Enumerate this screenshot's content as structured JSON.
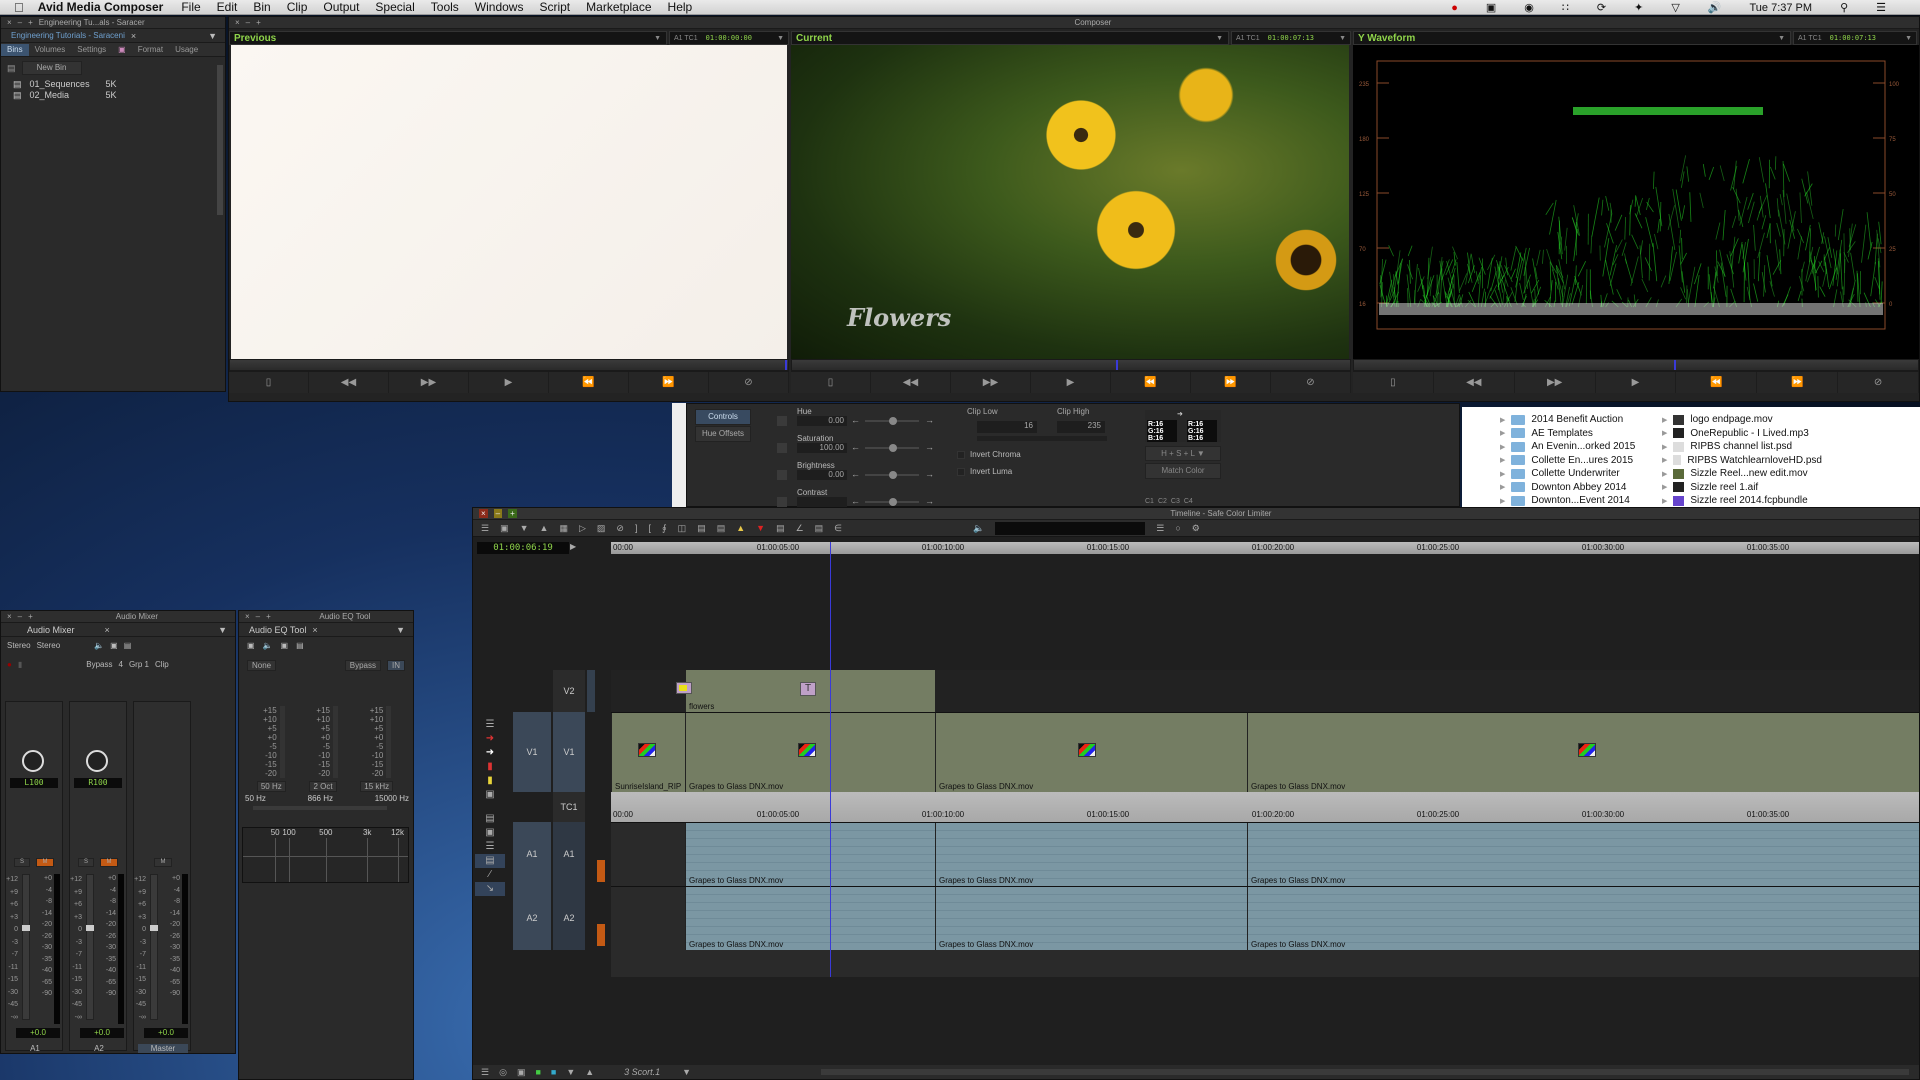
{
  "menubar": {
    "app": "Avid Media Composer",
    "items": [
      "File",
      "Edit",
      "Bin",
      "Clip",
      "Output",
      "Special",
      "Tools",
      "Windows",
      "Script",
      "Marketplace",
      "Help"
    ],
    "clock": "Tue 7:37 PM"
  },
  "project": {
    "window_title": "Engineering Tu...als - Saracer",
    "tab_label": "Engineering Tutorials - Saraceni",
    "tabs": [
      "Bins",
      "Volumes",
      "Settings",
      "Format",
      "Usage"
    ],
    "new_bin_label": "New Bin",
    "bins": [
      {
        "name": "01_Sequences",
        "size": "5K"
      },
      {
        "name": "02_Media",
        "size": "5K"
      }
    ]
  },
  "composer": {
    "title": "Composer",
    "previous": {
      "label": "Previous",
      "track": "A1 TC1",
      "tc": "01:00:00:00"
    },
    "current": {
      "label": "Current",
      "track": "A1 TC1",
      "tc": "01:00:07:13",
      "overlay_title": "Flowers"
    },
    "waveform": {
      "label": "Y Waveform",
      "track": "A1 TC1",
      "tc": "01:00:07:13",
      "left_scale": [
        "235",
        "180",
        "125",
        "70",
        "16"
      ],
      "right_scale": [
        "100",
        "75",
        "50",
        "25",
        "0"
      ]
    },
    "transport": [
      "mark-clip",
      "step-back",
      "step-forward",
      "play",
      "go-in",
      "go-out",
      "clear-marks"
    ]
  },
  "color_effect": {
    "tabs": [
      "Controls",
      "Hue Offsets"
    ],
    "params": [
      {
        "label": "Hue",
        "value": "0.00"
      },
      {
        "label": "Saturation",
        "value": "100.00"
      },
      {
        "label": "Brightness",
        "value": "0.00"
      },
      {
        "label": "Contrast",
        "value": ""
      }
    ],
    "clip_low_label": "Clip Low",
    "clip_low": "16",
    "clip_high_label": "Clip High",
    "clip_high": "235",
    "invert_chroma": "Invert Chroma",
    "invert_luma": "Invert Luma",
    "swatch_a": [
      "R:16",
      "G:16",
      "B:16"
    ],
    "swatch_b": [
      "R:16",
      "G:16",
      "B:16"
    ],
    "mode": "H + S + L",
    "match_color": "Match Color",
    "cbuttons": [
      "C1",
      "C2",
      "C3",
      "C4"
    ]
  },
  "finder": {
    "col1": [
      "2014 Benefit Auction",
      "AE Templates",
      "An Evenin...orked 2015",
      "Collette En...ures 2015",
      "Collette Underwriter",
      "Downton Abbey 2014",
      "Downton...Event 2014"
    ],
    "col2": [
      "logo endpage.mov",
      "OneRepublic - I Lived.mp3",
      "RIPBS channel list.psd",
      "RIPBS WatchlearnloveHD.psd",
      "Sizzle Reel...new edit.mov",
      "Sizzle reel 1.aif",
      "Sizzle reel 2014.fcpbundle"
    ]
  },
  "timeline": {
    "title": "Timeline - Safe Color Limiter",
    "master_tc": "01:00:06:19",
    "ruler": [
      "00:00",
      "01:00:05:00",
      "01:00:10:00",
      "01:00:15:00",
      "01:00:20:00",
      "01:00:25:00",
      "01:00:30:00",
      "01:00:35:00"
    ],
    "tc_ruler": [
      "00:00",
      "01:00:05:00",
      "01:00:10:00",
      "01:00:15:00",
      "01:00:20:00",
      "01:00:25:00",
      "01:00:30:00",
      "01:00:35:00"
    ],
    "tracks": {
      "v2": "V2",
      "v1_src": "V1",
      "v1": "V1",
      "tc1": "TC1",
      "a1_src": "A1",
      "a1": "A1",
      "a2_src": "A2",
      "a2": "A2"
    },
    "v2_clip": "flowers",
    "v1_clips": [
      "SunriseIsland_RIP",
      "Grapes to Glass DNX.mov",
      "Grapes to Glass DNX.mov",
      "Grapes to Glass DNX.mov"
    ],
    "a_clips": [
      "Grapes to Glass DNX.mov",
      "Grapes to Glass DNX.mov",
      "Grapes to Glass DNX.mov"
    ],
    "audio_scale": [
      "12",
      "+6",
      "0",
      "-7",
      "-15",
      "-45"
    ],
    "sequence": "3 Scort.1"
  },
  "audio_mixer": {
    "window_title": "Audio Mixer",
    "tab": "Audio Mixer",
    "mode1": "Stereo",
    "mode2": "Stereo",
    "bypass": "Bypass",
    "bank": "4",
    "group": "Grp 1",
    "clip": "Clip",
    "channels": [
      {
        "name": "A1",
        "pan": "L100",
        "gain": "+0.0"
      },
      {
        "name": "A2",
        "pan": "R100",
        "gain": "+0.0"
      },
      {
        "name": "Master",
        "pan": "",
        "gain": "+0.0"
      }
    ],
    "fader_scale": [
      "+12",
      "+9",
      "+6",
      "+3",
      "0",
      "-3",
      "-7",
      "-11",
      "-15",
      "-30",
      "-45",
      "-∞"
    ],
    "meter_scale": [
      "+0",
      "-4",
      "-8",
      "-14",
      "-20",
      "-26",
      "-30",
      "-35",
      "-40",
      "-65",
      "-90"
    ]
  },
  "audio_eq": {
    "window_title": "Audio EQ Tool",
    "tab": "Audio EQ Tool",
    "preset": "None",
    "bypass": "Bypass",
    "in": "IN",
    "scale": [
      "+15",
      "+10",
      "+5",
      "+0",
      "-5",
      "-10",
      "-15",
      "-20"
    ],
    "bands": [
      "50 Hz",
      "2 Oct",
      "15 kHz"
    ],
    "range": [
      "50 Hz",
      "866 Hz",
      "15000 Hz"
    ],
    "graph_labels": [
      "50",
      "100",
      "500",
      "3k",
      "12k"
    ]
  }
}
